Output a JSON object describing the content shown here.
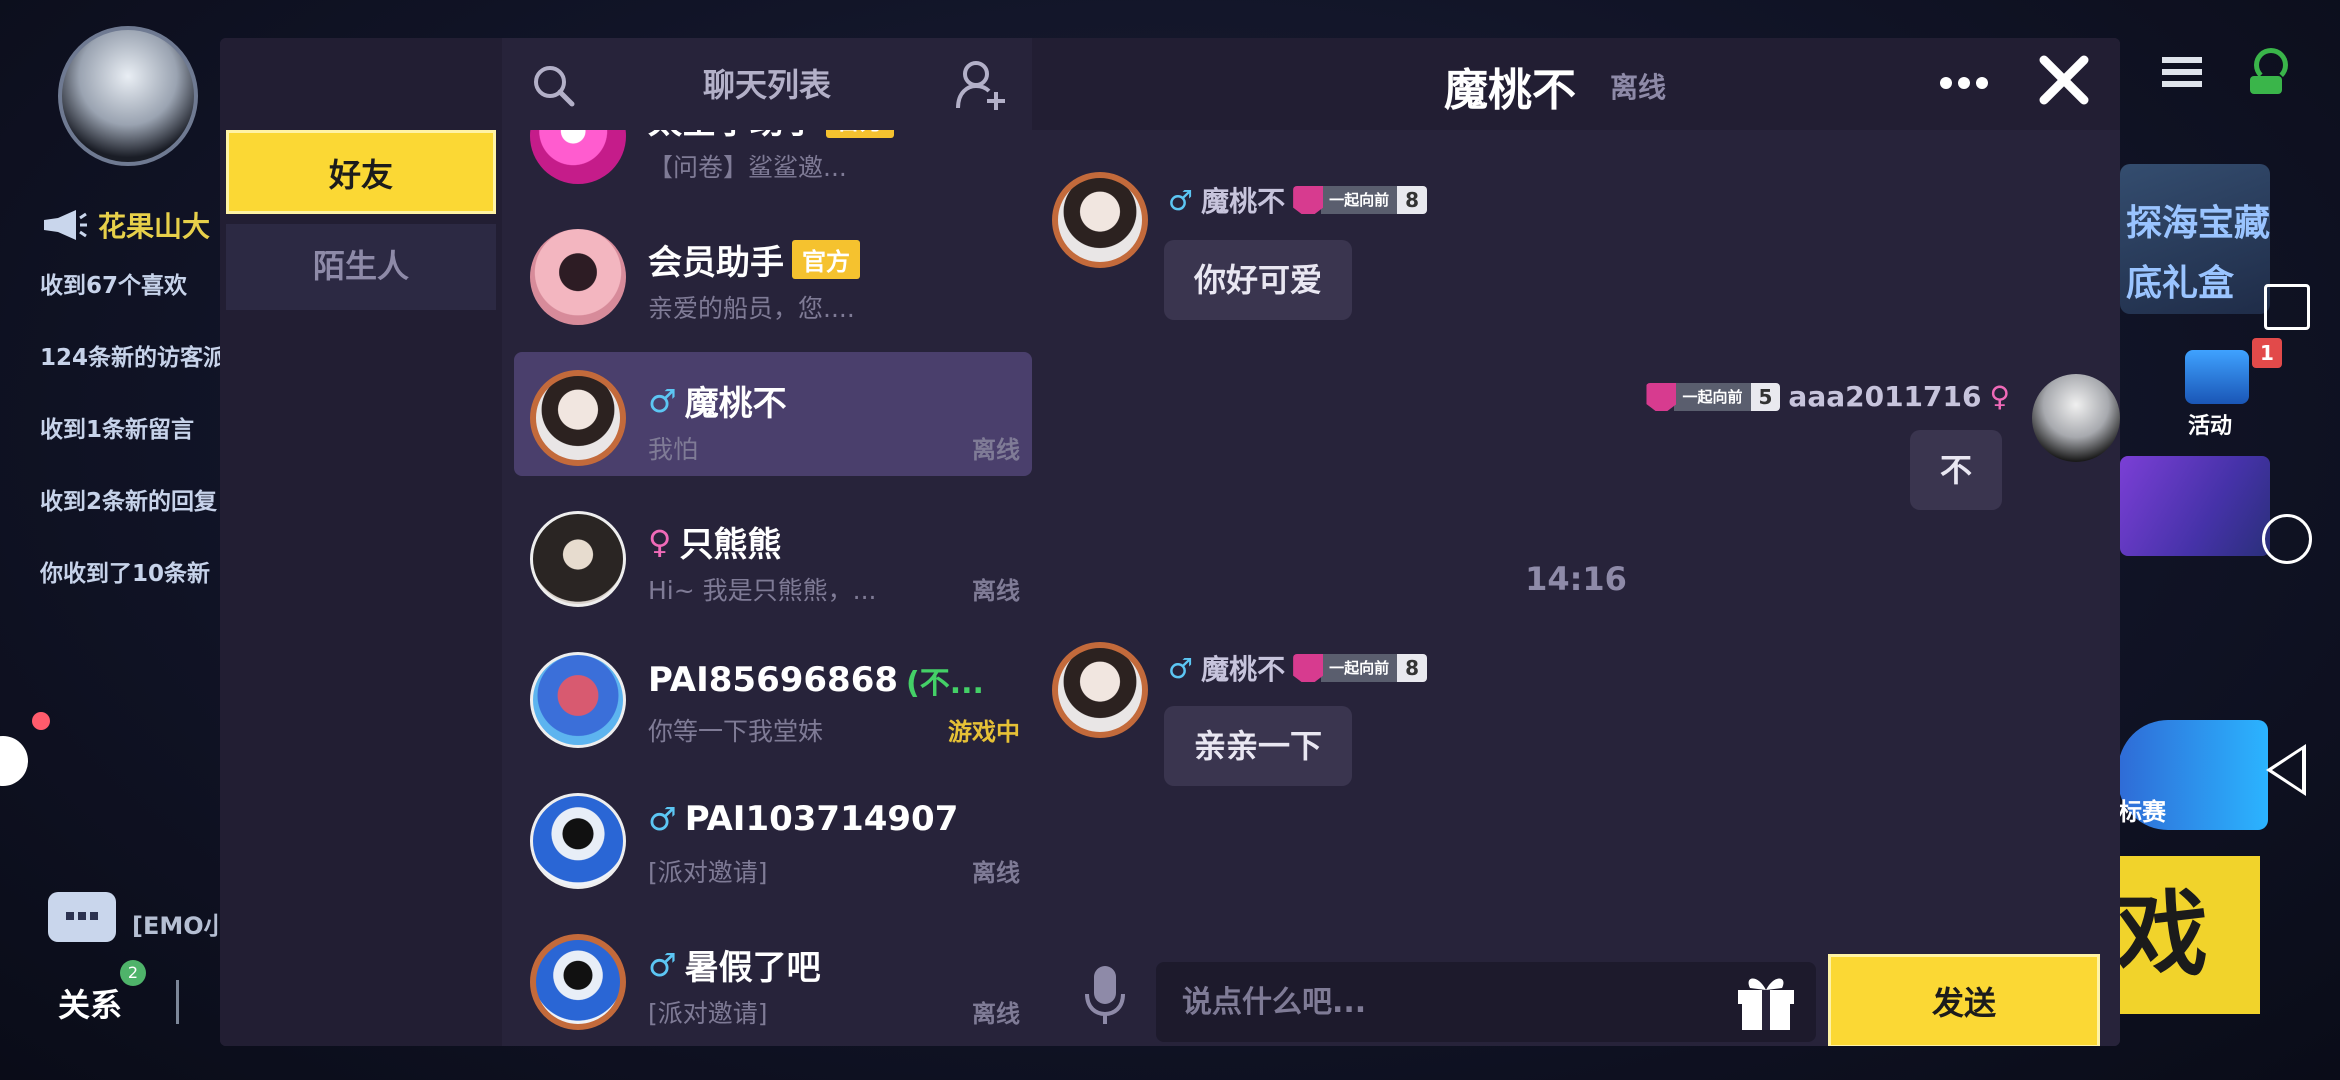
{
  "background": {
    "news_title": "花果山大",
    "news_items": [
      "收到67个喜欢",
      "124条新的访客派",
      "收到1条新留言",
      "收到2条新的回复",
      "你收到了10条新"
    ],
    "emo_text": "[EMO小",
    "relation_label": "关系",
    "relation_badge": "2",
    "activity_label": "活动",
    "activity_badge": "1",
    "banner_text": "探海宝藏\n底礼盒",
    "biaosai_label": "标赛",
    "yellow_text": "戏"
  },
  "tabs": {
    "friends": "好友",
    "strangers": "陌生人"
  },
  "list": {
    "title": "聊天列表",
    "items": [
      {
        "name": "太空小助手",
        "badge": "官方",
        "sub": "【问卷】鲨鲨邀...",
        "status": "",
        "avatar": "pink"
      },
      {
        "name": "会员助手",
        "badge": "官方",
        "sub": "亲爱的船员，您....",
        "status": "",
        "avatar": "member"
      },
      {
        "gender": "♂",
        "name": "魔桃不",
        "sub": "我怕",
        "status": "离线",
        "avatar": "boy"
      },
      {
        "gender": "♀",
        "name": "只熊熊",
        "sub": "Hi~ 我是只熊熊，...",
        "status": "离线",
        "avatar": "girl"
      },
      {
        "name": "PAI85696868",
        "name_suffix": "(不...",
        "sub": "你等一下我堂妹",
        "status": "游戏中",
        "avatar": "robot"
      },
      {
        "gender": "♂",
        "name": "PAI103714907",
        "sub": "[派对邀请]",
        "status": "离线",
        "avatar": "astro"
      },
      {
        "gender": "♂",
        "name": "暑假了吧",
        "sub": "[派对邀请]",
        "status": "离线",
        "avatar": "astro-frame"
      }
    ]
  },
  "chat": {
    "name": "魔桃不",
    "status": "离线",
    "messages": [
      {
        "sender_gender": "♂",
        "sender": "魔桃不",
        "level_label": "一起向前",
        "level": "8",
        "text": "你好可爱"
      },
      {
        "sender_gender": "♀",
        "sender": "aaa2011716",
        "level_label": "一起向前",
        "level": "5",
        "text": "不"
      },
      {
        "sender_gender": "♂",
        "sender": "魔桃不",
        "level_label": "一起向前",
        "level": "8",
        "text": "亲亲一下"
      }
    ],
    "time_separator": "14:16",
    "input_placeholder": "说点什么吧...",
    "send_label": "发送"
  },
  "colors": {
    "accent_yellow": "#fbd834",
    "panel_bg": "#27233a",
    "selected_bg": "#4a3f6c",
    "male_blue": "#5cc6f3",
    "female_pink": "#f06ab8",
    "playing_gold": "#e6c136",
    "online_green": "#44d067"
  }
}
